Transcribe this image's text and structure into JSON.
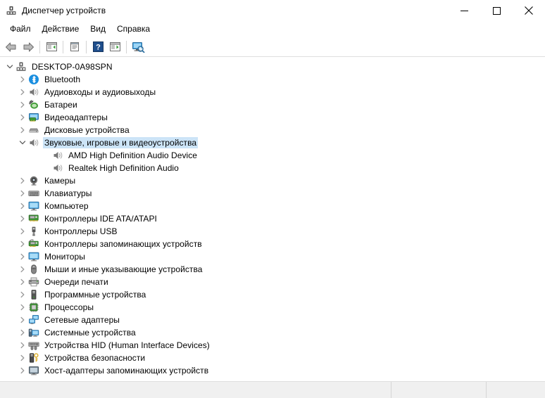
{
  "window": {
    "title": "Диспетчер устройств",
    "icon": "device-manager-icon",
    "minimize_label": "—",
    "maximize_label": "□",
    "close_label": "✕"
  },
  "menubar": {
    "items": [
      {
        "label": "Файл",
        "name": "menu-file"
      },
      {
        "label": "Действие",
        "name": "menu-action"
      },
      {
        "label": "Вид",
        "name": "menu-view"
      },
      {
        "label": "Справка",
        "name": "menu-help"
      }
    ]
  },
  "toolbar": {
    "buttons": [
      {
        "name": "back-button",
        "icon": "back-arrow-icon",
        "tooltip": "Назад"
      },
      {
        "name": "forward-button",
        "icon": "forward-arrow-icon",
        "tooltip": "Вперед"
      },
      {
        "name": "show-hide-tree-button",
        "icon": "tree-panel-icon",
        "tooltip": "Показать или скрыть дерево консоли"
      },
      {
        "name": "properties-button",
        "icon": "properties-icon",
        "tooltip": "Свойства"
      },
      {
        "name": "help-button",
        "icon": "help-question-icon",
        "tooltip": "Справка"
      },
      {
        "name": "update-driver-button",
        "icon": "update-driver-icon",
        "tooltip": "Обновить конфигурацию оборудования"
      },
      {
        "name": "scan-hardware-button",
        "icon": "scan-monitor-icon",
        "tooltip": "Обновить конфигурацию оборудования"
      }
    ]
  },
  "tree": {
    "root": {
      "label": "DESKTOP-0A98SPN",
      "icon": "computer-root-icon",
      "expanded": true
    },
    "nodes": [
      {
        "label": "Bluetooth",
        "icon": "bluetooth-icon",
        "expanded": false,
        "selected": false,
        "children": []
      },
      {
        "label": "Аудиовходы и аудиовыходы",
        "icon": "speaker-icon",
        "expanded": false,
        "selected": false,
        "children": []
      },
      {
        "label": "Батареи",
        "icon": "battery-plug-icon",
        "expanded": false,
        "selected": false,
        "children": []
      },
      {
        "label": "Видеоадаптеры",
        "icon": "display-adapter-icon",
        "expanded": false,
        "selected": false,
        "children": []
      },
      {
        "label": "Дисковые устройства",
        "icon": "disk-drive-icon",
        "expanded": false,
        "selected": false,
        "children": []
      },
      {
        "label": "Звуковые, игровые и видеоустройства",
        "icon": "speaker-icon",
        "expanded": true,
        "selected": true,
        "children": [
          {
            "label": "AMD High Definition Audio Device",
            "icon": "speaker-icon"
          },
          {
            "label": "Realtek High Definition Audio",
            "icon": "speaker-icon"
          }
        ]
      },
      {
        "label": "Камеры",
        "icon": "camera-icon",
        "expanded": false,
        "selected": false,
        "children": []
      },
      {
        "label": "Клавиатуры",
        "icon": "keyboard-icon",
        "expanded": false,
        "selected": false,
        "children": []
      },
      {
        "label": "Компьютер",
        "icon": "monitor-icon",
        "expanded": false,
        "selected": false,
        "children": []
      },
      {
        "label": "Контроллеры IDE ATA/ATAPI",
        "icon": "ide-controller-icon",
        "expanded": false,
        "selected": false,
        "children": []
      },
      {
        "label": "Контроллеры USB",
        "icon": "usb-icon",
        "expanded": false,
        "selected": false,
        "children": []
      },
      {
        "label": "Контроллеры запоминающих устройств",
        "icon": "storage-controller-icon",
        "expanded": false,
        "selected": false,
        "children": []
      },
      {
        "label": "Мониторы",
        "icon": "monitor-icon",
        "expanded": false,
        "selected": false,
        "children": []
      },
      {
        "label": "Мыши и иные указывающие устройства",
        "icon": "mouse-icon",
        "expanded": false,
        "selected": false,
        "children": []
      },
      {
        "label": "Очереди печати",
        "icon": "printer-icon",
        "expanded": false,
        "selected": false,
        "children": []
      },
      {
        "label": "Программные устройства",
        "icon": "software-device-icon",
        "expanded": false,
        "selected": false,
        "children": []
      },
      {
        "label": "Процессоры",
        "icon": "processor-icon",
        "expanded": false,
        "selected": false,
        "children": []
      },
      {
        "label": "Сетевые адаптеры",
        "icon": "network-adapter-icon",
        "expanded": false,
        "selected": false,
        "children": []
      },
      {
        "label": "Системные устройства",
        "icon": "system-device-icon",
        "expanded": false,
        "selected": false,
        "children": []
      },
      {
        "label": "Устройства HID (Human Interface Devices)",
        "icon": "hid-icon",
        "expanded": false,
        "selected": false,
        "children": []
      },
      {
        "label": "Устройства безопасности",
        "icon": "security-device-icon",
        "expanded": false,
        "selected": false,
        "children": []
      },
      {
        "label": "Хост-адаптеры запоминающих устройств",
        "icon": "host-adapter-icon",
        "expanded": false,
        "selected": false,
        "children": []
      }
    ]
  },
  "statusbar": {
    "pane1": "",
    "pane2": "",
    "pane3": ""
  },
  "colors": {
    "selection": "#cce4f7",
    "window_bg": "#ffffff",
    "statusbar_bg": "#f0f0f0",
    "border": "#dfdfdf",
    "text": "#000000",
    "chevron": "#989898",
    "bluetooth_blue": "#1b8fe0",
    "accent_green": "#35a035",
    "monitor_blue": "#3fa9e8"
  }
}
